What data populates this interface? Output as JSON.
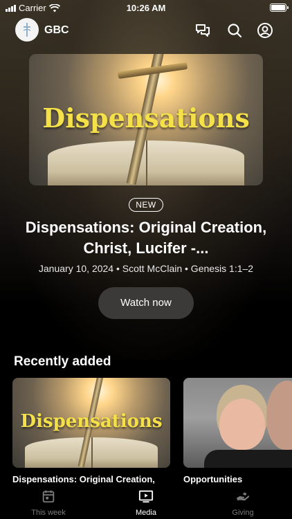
{
  "status_bar": {
    "carrier": "Carrier",
    "time": "10:26 AM"
  },
  "header": {
    "brand": "GBC",
    "icons": [
      "chat-icon",
      "search-icon",
      "account-icon"
    ]
  },
  "hero": {
    "artwork_text": "Dispensations",
    "badge": "NEW",
    "title": "Dispensations: Original Creation, Christ, Lucifer -...",
    "meta": "January 10, 2024 • Scott McClain • Genesis 1:1–2",
    "button": "Watch now"
  },
  "recently_added": {
    "title": "Recently added",
    "items": [
      {
        "label": "Dispensations: Original Creation,",
        "artwork_text": "Dispensations"
      },
      {
        "label": "Opportunities"
      }
    ]
  },
  "tab_bar": {
    "tabs": [
      {
        "label": "This week",
        "icon": "calendar-icon"
      },
      {
        "label": "Media",
        "icon": "play-icon"
      },
      {
        "label": "Giving",
        "icon": "giving-hand-icon"
      }
    ]
  }
}
